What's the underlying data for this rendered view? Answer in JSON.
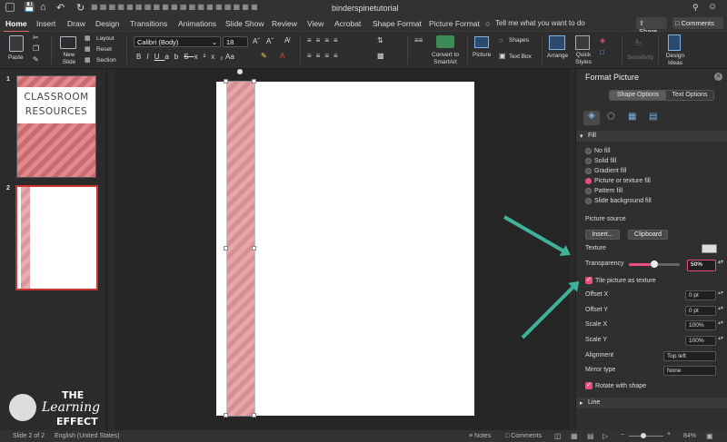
{
  "document": {
    "title": "binderspinetutorial"
  },
  "ribbon_tabs": [
    {
      "label": "Home",
      "active": true
    },
    {
      "label": "Insert"
    },
    {
      "label": "Draw"
    },
    {
      "label": "Design"
    },
    {
      "label": "Transitions"
    },
    {
      "label": "Animations"
    },
    {
      "label": "Slide Show"
    },
    {
      "label": "Review"
    },
    {
      "label": "View"
    },
    {
      "label": "Acrobat"
    },
    {
      "label": "Shape Format"
    },
    {
      "label": "Picture Format"
    }
  ],
  "tell_me": "Tell me what you want to do",
  "share_label": "Share",
  "comments_label": "Comments",
  "ribbon": {
    "paste": "Paste",
    "new_slide": "New Slide",
    "layout": "Layout",
    "reset": "Reset",
    "section": "Section",
    "font_name": "Calibri (Body)",
    "font_size": "18",
    "convert": "Convert to SmartArt",
    "picture": "Picture",
    "shapes": "Shapes",
    "text_box": "Text Box",
    "arrange": "Arrange",
    "quick_styles": "Quick Styles",
    "sensitivity": "Sensitivity",
    "design_ideas": "Design Ideas"
  },
  "thumbnails": [
    {
      "number": "1",
      "text": "CLASSROOM RESOURCES"
    },
    {
      "number": "2"
    }
  ],
  "format_pane": {
    "title": "Format Picture",
    "tabs": [
      "Shape Options",
      "Text Options"
    ],
    "fill_header": "Fill",
    "fill_options": [
      {
        "label": "No fill",
        "selected": false
      },
      {
        "label": "Solid fill",
        "selected": false
      },
      {
        "label": "Gradient fill",
        "selected": false
      },
      {
        "label": "Picture or texture fill",
        "selected": true
      },
      {
        "label": "Pattern fill",
        "selected": false
      },
      {
        "label": "Slide background fill",
        "selected": false
      }
    ],
    "picture_source": "Picture source",
    "insert_btn": "Insert...",
    "clipboard_btn": "Clipboard",
    "texture": "Texture",
    "transparency_label": "Transparency",
    "transparency_value": "50%",
    "transparency_fraction": 0.5,
    "tile_label": "Tile picture as texture",
    "offset_x_label": "Offset X",
    "offset_x": "0 pt",
    "offset_y_label": "Offset Y",
    "offset_y": "0 pt",
    "scale_x_label": "Scale X",
    "scale_x": "100%",
    "scale_y_label": "Scale Y",
    "scale_y": "100%",
    "alignment_label": "Alignment",
    "alignment": "Top left",
    "mirror_label": "Mirror type",
    "mirror": "None",
    "rotate_label": "Rotate with shape",
    "line_header": "Line"
  },
  "status": {
    "slide": "Slide 2 of 2",
    "language": "English (United States)",
    "notes": "Notes",
    "comments": "Comments",
    "zoom": "84%"
  },
  "logo": {
    "line1": "THE",
    "line2": "Learning",
    "line3": "EFFECT"
  },
  "colors": {
    "accent": "#e84f7b",
    "arrow": "#3fb39a",
    "chevron_a": "#e08a8e",
    "chevron_b": "#c96a70"
  }
}
